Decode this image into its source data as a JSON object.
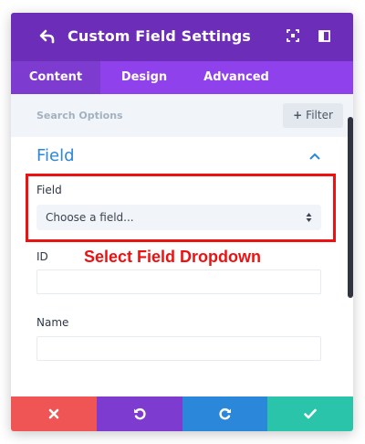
{
  "header": {
    "title": "Custom Field Settings",
    "background": "#6c2eb9"
  },
  "tabs": [
    {
      "label": "Content",
      "active": true
    },
    {
      "label": "Design",
      "active": false
    },
    {
      "label": "Advanced",
      "active": false
    }
  ],
  "search": {
    "placeholder": "Search Options",
    "filter_label": "Filter"
  },
  "section": {
    "title": "Field",
    "accent": "#2b87da"
  },
  "fields": {
    "field_label": "Field",
    "field_select_value": "Choose a field...",
    "id_label": "ID",
    "id_value": "",
    "name_label": "Name",
    "name_value": ""
  },
  "annotation": {
    "text": "Select Field Dropdown",
    "color": "#ee1111"
  },
  "footer": {
    "discard_color": "#ef5555",
    "undo_color": "#7e3bd0",
    "redo_color": "#2b87da",
    "save_color": "#29c4a9"
  },
  "icons": {
    "back": "back-arrow-icon",
    "expand": "expand-icon",
    "split": "split-view-icon",
    "collapse": "chevron-up-icon",
    "select_arrows": "up-down-arrows-icon",
    "discard": "close-icon",
    "undo": "undo-icon",
    "redo": "redo-icon",
    "save": "checkmark-icon"
  }
}
